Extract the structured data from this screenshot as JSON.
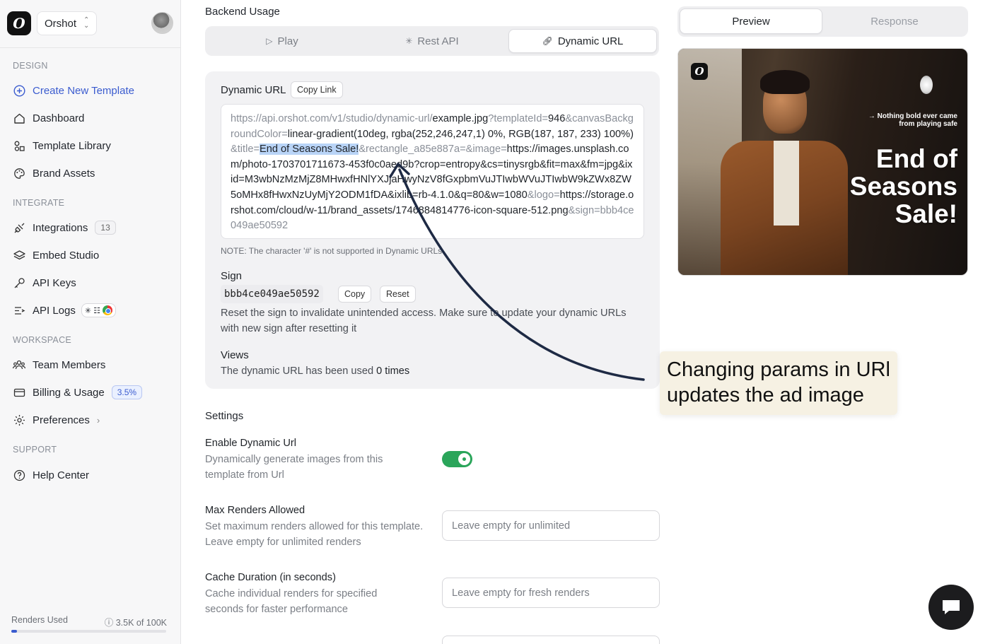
{
  "sidebar": {
    "org_name": "Orshot",
    "logo_glyph": "O",
    "sections": {
      "design": "DESIGN",
      "integrate": "INTEGRATE",
      "workspace": "WORKSPACE",
      "support": "SUPPORT"
    },
    "items": {
      "create_template": "Create New Template",
      "dashboard": "Dashboard",
      "template_library": "Template Library",
      "brand_assets": "Brand Assets",
      "integrations": "Integrations",
      "integrations_count": "13",
      "embed_studio": "Embed Studio",
      "api_keys": "API Keys",
      "api_logs": "API Logs",
      "team_members": "Team Members",
      "billing": "Billing & Usage",
      "billing_badge": "3.5%",
      "preferences": "Preferences",
      "help_center": "Help Center"
    },
    "renders_label": "Renders Used",
    "renders_value": "3.5K of 100K",
    "renders_fraction": 0.035
  },
  "main": {
    "backend_usage": "Backend Usage",
    "tabs": {
      "play": "Play",
      "rest_api": "Rest API",
      "dynamic_url": "Dynamic URL"
    },
    "dynamic_url_label": "Dynamic URL",
    "copy_link": "Copy Link",
    "url_parts": {
      "p1": "https://api.orshot.com/v1/studio/dynamic-url/",
      "p2": "example.jpg",
      "p3": "?templateId=",
      "p4": "946",
      "p5": "&canvasBackgroundColor=",
      "p6": "linear-gradient(10deg, rgba(252,246,247,1) 0%, RGB(187, 187, 233) 100%)",
      "p7": "&title=",
      "p8": "End of Seasons Sale!",
      "p9": "&rectangle_a85e887a=&image=",
      "p10": "https://images.unsplash.com/photo-1703701711673-453f0c0aed9b?crop=entropy&cs=tinysrgb&fit=max&fm=jpg&ixid=M3wbNzMzMjZ8MHwxfHNlYXJjaHwyNzV8fGxpbmVuJTIwbWVuJTIwbW9kZWx8ZW5oMHx8fHwxNzUyMjY2ODM1fDA&ixlib=rb-4.1.0&q=80&w=1080",
      "p11": "&logo=",
      "p12": "https://storage.orshot.com/cloud/w-11/brand_assets/1746884814776-icon-square-512.png",
      "p13": "&sign=bbb4ce049ae50592"
    },
    "note": "NOTE: The character '#' is not supported in Dynamic URLs",
    "sign_label": "Sign",
    "sign_value": "bbb4ce049ae50592",
    "copy": "Copy",
    "reset": "Reset",
    "sign_desc": "Reset the sign to invalidate unintended access. Make sure to update your dynamic URLs with new sign after resetting it",
    "views_label": "Views",
    "views_prefix": "The dynamic URL has been used",
    "views_count": "0 times",
    "settings": "Settings",
    "enable_label": "Enable Dynamic Url",
    "enable_desc": "Dynamically generate images from this template from Url",
    "enable_on": true,
    "max_label": "Max Renders Allowed",
    "max_desc": "Set maximum renders allowed for this template. Leave empty for unlimited renders",
    "max_placeholder": "Leave empty for unlimited",
    "cache_label": "Cache Duration (in seconds)",
    "cache_desc": "Cache individual renders for specified seconds for faster performance",
    "cache_placeholder": "Leave empty for fresh renders"
  },
  "right": {
    "tab_preview": "Preview",
    "tab_response": "Response",
    "preview_tag": "→ Nothing bold ever came from playing safe",
    "preview_title": "End of Seasons Sale!"
  },
  "callout": "Changing params in URl updates the ad image",
  "colors": {
    "accent": "#3b5ccf",
    "toggle_on": "#2aa55a",
    "callout_bg": "#f6f1e3",
    "highlight": "#b9d4f7"
  }
}
